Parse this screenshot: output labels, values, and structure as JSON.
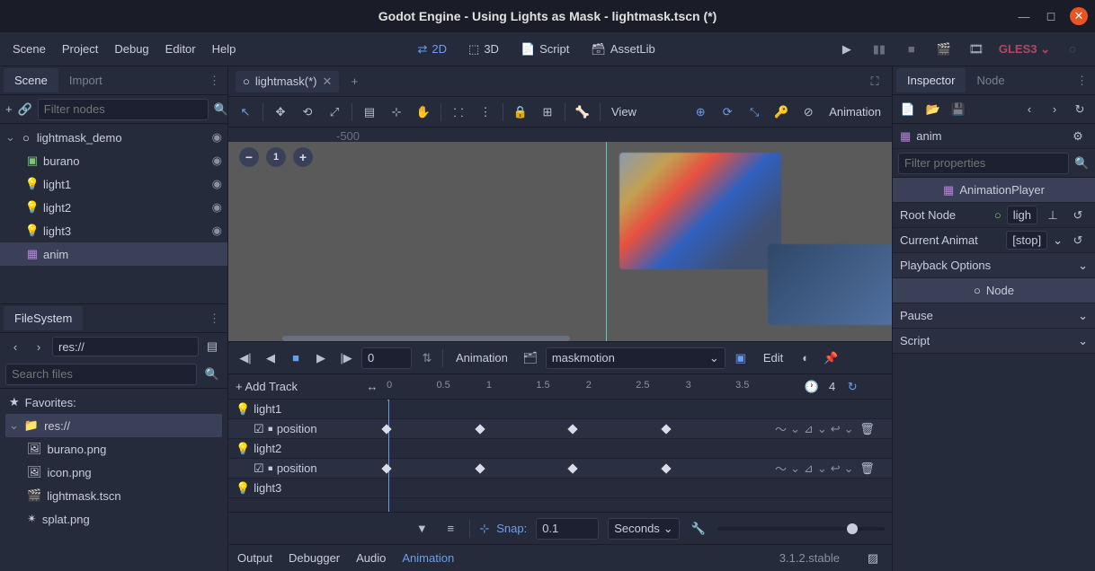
{
  "window": {
    "title": "Godot Engine - Using Lights as Mask - lightmask.tscn (*)"
  },
  "menubar": {
    "items": [
      "Scene",
      "Project",
      "Debug",
      "Editor",
      "Help"
    ]
  },
  "modes": {
    "d2": "2D",
    "d3": "3D",
    "script": "Script",
    "assetlib": "AssetLib"
  },
  "renderer": "GLES3",
  "scene_panel": {
    "tab_scene": "Scene",
    "tab_import": "Import",
    "filter_placeholder": "Filter nodes",
    "tree": [
      {
        "name": "lightmask_demo",
        "type": "root"
      },
      {
        "name": "burano",
        "type": "sprite"
      },
      {
        "name": "light1",
        "type": "light"
      },
      {
        "name": "light2",
        "type": "light"
      },
      {
        "name": "light3",
        "type": "light"
      },
      {
        "name": "anim",
        "type": "anim",
        "selected": true
      }
    ]
  },
  "filesystem": {
    "title": "FileSystem",
    "path": "res://",
    "search_placeholder": "Search files",
    "favorites": "Favorites:",
    "root": "res://",
    "files": [
      "burano.png",
      "icon.png",
      "lightmask.tscn",
      "splat.png"
    ]
  },
  "scene_tabs": {
    "open": "lightmask(*)"
  },
  "canvas_toolbar": {
    "view": "View",
    "anim": "Animation"
  },
  "ruler_tick": "-500",
  "animation": {
    "pos": "0",
    "label": "Animation",
    "name": "maskmotion",
    "edit": "Edit",
    "add_track": "+ Add Track",
    "ticks": [
      "0",
      "0.5",
      "1",
      "1.5",
      "2",
      "2.5",
      "3",
      "3.5"
    ],
    "length": "4",
    "tracks": [
      {
        "name": "light1",
        "prop": "position",
        "keys": [
          0,
          1,
          2,
          3
        ]
      },
      {
        "name": "light2",
        "prop": "position",
        "keys": [
          0,
          1,
          2,
          3
        ]
      },
      {
        "name": "light3"
      }
    ],
    "snap_label": "Snap:",
    "snap_val": "0.1",
    "units": "Seconds"
  },
  "bottom_tabs": {
    "output": "Output",
    "debugger": "Debugger",
    "audio": "Audio",
    "animation": "Animation"
  },
  "version": "3.1.2.stable",
  "inspector": {
    "tab_inspector": "Inspector",
    "tab_node": "Node",
    "node_name": "anim",
    "filter_placeholder": "Filter properties",
    "class": "AnimationPlayer",
    "root_label": "Root Node",
    "root_val": "ligh",
    "current_label": "Current Animat",
    "current_val": "[stop]",
    "playback": "Playback Options",
    "node_cat": "Node",
    "pause": "Pause",
    "script": "Script"
  }
}
